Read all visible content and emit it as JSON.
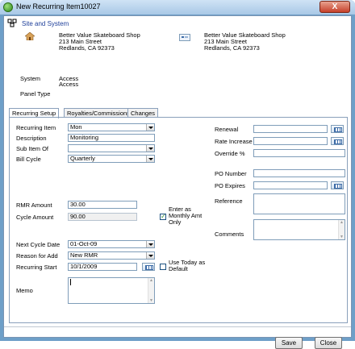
{
  "window": {
    "title": "New Recurring Item10027",
    "close_label": "X"
  },
  "site": {
    "heading": "Site and System",
    "address_left": {
      "name": "Better Value Skateboard Shop",
      "street": "213 Main Street",
      "city": "Redlands, CA  92373"
    },
    "address_right": {
      "name": "Better Value Skateboard Shop",
      "street": "213 Main Street",
      "city": "Redlands, CA  92373"
    },
    "system_label": "System",
    "system_value1": "Access",
    "system_value2": "Access",
    "panel_type_label": "Panel Type"
  },
  "tabs": [
    {
      "label": "Recurring Setup",
      "active": true
    },
    {
      "label": "Royalties/Commissions",
      "active": false
    },
    {
      "label": "Changes",
      "active": false
    }
  ],
  "form": {
    "recurring_item": {
      "label": "Recurring Item",
      "value": "Mon"
    },
    "description": {
      "label": "Description",
      "value": "Monitoring"
    },
    "sub_item_of": {
      "label": "Sub Item Of",
      "value": ""
    },
    "bill_cycle": {
      "label": "Bill Cycle",
      "value": "Quarterly"
    },
    "rmr_amount": {
      "label": "RMR Amount",
      "value": "30.00"
    },
    "cycle_amount": {
      "label": "Cycle Amount",
      "value": "90.00"
    },
    "enter_monthly": {
      "label_line1": "Enter as",
      "label_line2": "Monthly Amt",
      "label_line3": "Only",
      "checked": true
    },
    "next_cycle_date": {
      "label": "Next Cycle Date",
      "value": "01-Oct-09"
    },
    "reason_for_add": {
      "label": "Reason for Add",
      "value": "New RMR"
    },
    "recurring_start": {
      "label": "Recurring Start",
      "value": "10/1/2009"
    },
    "use_today": {
      "label_line1": "Use Today as",
      "label_line2": "Default",
      "checked": false
    },
    "memo": {
      "label": "Memo",
      "value": ""
    },
    "renewal": {
      "label": "Renewal",
      "value": ""
    },
    "rate_increase": {
      "label": "Rate Increase",
      "value": ""
    },
    "override_pct": {
      "label": "Override %",
      "value": ""
    },
    "po_number": {
      "label": "PO Number",
      "value": ""
    },
    "po_expires": {
      "label": "PO Expires",
      "value": ""
    },
    "reference": {
      "label": "Reference",
      "value": ""
    },
    "comments": {
      "label": "Comments",
      "value": ""
    }
  },
  "buttons": {
    "save": "Save",
    "close": "Close"
  },
  "icons": {
    "site": "site-system-icon",
    "house": "house-icon",
    "map": "map-icon",
    "calendar": "calendar-icon"
  }
}
